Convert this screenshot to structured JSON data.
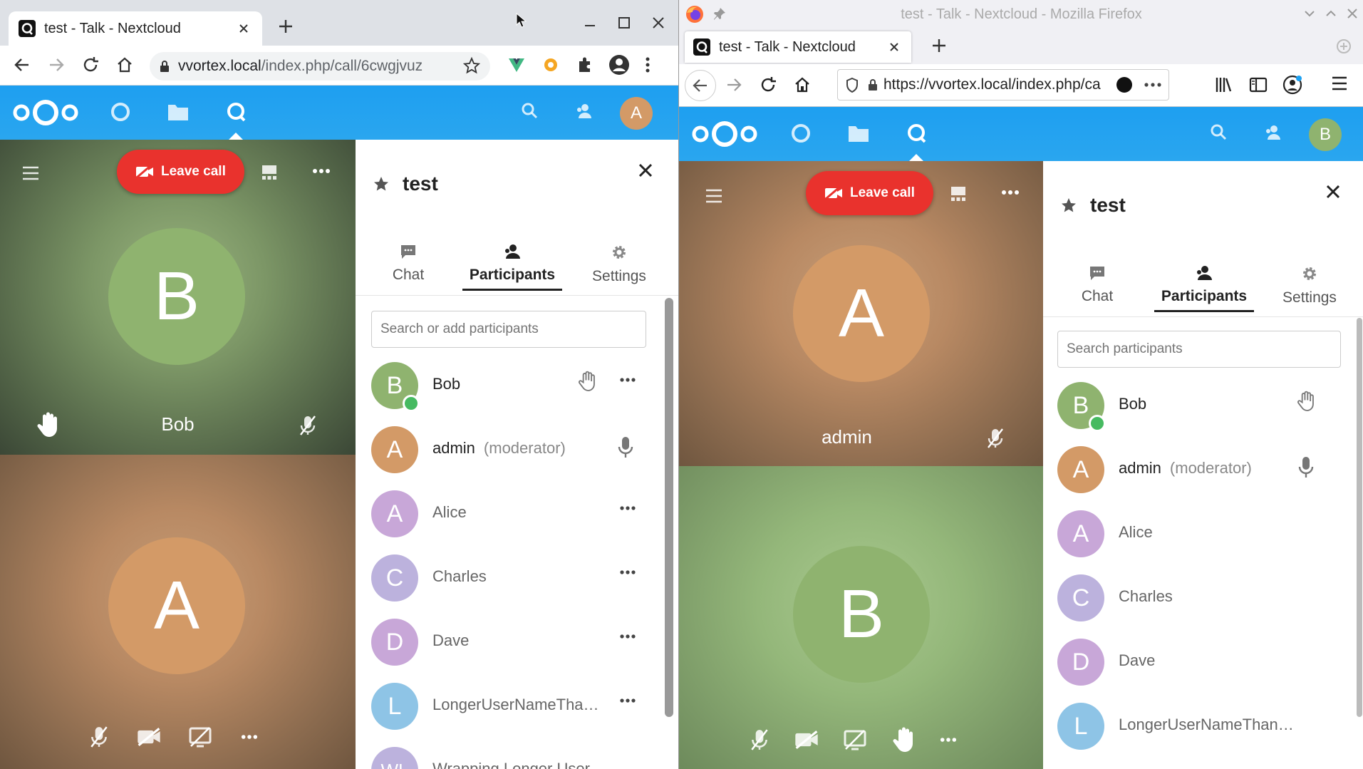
{
  "colors": {
    "nextcloud_blue": "#1da1f2",
    "leave_red": "#e9322d",
    "online_green": "#46ba61",
    "avatar_green": "#8fb36f",
    "avatar_orange": "#d39a67",
    "avatar_purple": "#c8a7d8",
    "avatar_lilac": "#bcb2dd",
    "avatar_blue": "#8ec4e6"
  },
  "left": {
    "tab_title": "test - Talk - Nextcloud",
    "url_host": "vvortex.local",
    "url_path": "/index.php/call/6cwgjvuz",
    "header_avatar": "A",
    "call": {
      "leave_label": "Leave call",
      "tile1": {
        "initial": "B",
        "name": "Bob"
      },
      "tile2": {
        "initial": "A"
      }
    },
    "sidebar": {
      "title": "test",
      "tabs": [
        "Chat",
        "Participants",
        "Settings"
      ],
      "search_placeholder": "Search or add participants",
      "participants": [
        {
          "initial": "B",
          "name": "Bob"
        },
        {
          "initial": "A",
          "name": "admin",
          "role": "(moderator)"
        },
        {
          "initial": "A",
          "name": "Alice"
        },
        {
          "initial": "C",
          "name": "Charles"
        },
        {
          "initial": "D",
          "name": "Dave"
        },
        {
          "initial": "L",
          "name": "LongerUserNameTha…"
        },
        {
          "initial": "WL",
          "name": "Wrapping Longer User"
        }
      ]
    }
  },
  "right": {
    "window_title": "test - Talk - Nextcloud - Mozilla Firefox",
    "tab_title": "test - Talk - Nextcloud",
    "url": "https://vvortex.local/index.php/ca",
    "header_avatar": "B",
    "call": {
      "leave_label": "Leave call",
      "tile1": {
        "initial": "A",
        "name": "admin"
      },
      "tile2": {
        "initial": "B"
      }
    },
    "sidebar": {
      "title": "test",
      "tabs": [
        "Chat",
        "Participants",
        "Settings"
      ],
      "search_placeholder": "Search participants",
      "participants": [
        {
          "initial": "B",
          "name": "Bob"
        },
        {
          "initial": "A",
          "name": "admin",
          "role": "(moderator)"
        },
        {
          "initial": "A",
          "name": "Alice"
        },
        {
          "initial": "C",
          "name": "Charles"
        },
        {
          "initial": "D",
          "name": "Dave"
        },
        {
          "initial": "L",
          "name": "LongerUserNameThan…"
        }
      ]
    }
  }
}
